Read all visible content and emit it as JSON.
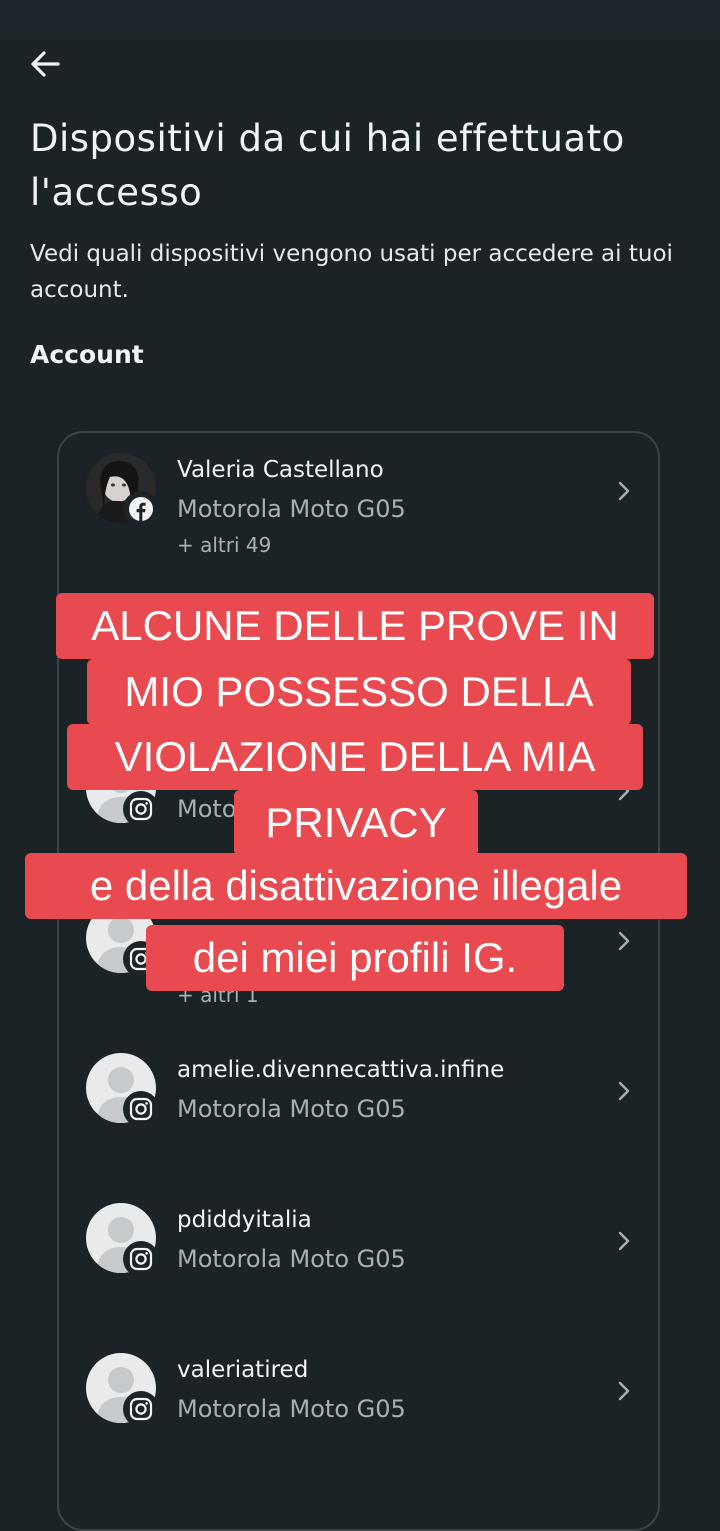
{
  "header": {
    "title": "Dispositivi da cui hai effettuato l'accesso",
    "subtitle": "Vedi quali dispositivi vengono usati per accedere ai tuoi account.",
    "section_label": "Account"
  },
  "accounts": [
    {
      "name": "Valeria Castellano",
      "device": "Motorola Moto G05",
      "more": "+ altri 49",
      "platform": "facebook",
      "avatar": "profile-photo"
    },
    {
      "name": "",
      "device": "Moto",
      "more": "",
      "platform": "instagram",
      "avatar": "default"
    },
    {
      "name": "",
      "device": "",
      "more": "+ altri 1",
      "platform": "instagram",
      "avatar": "default"
    },
    {
      "name": "amelie.divennecattiva.infine",
      "device": "Motorola Moto G05",
      "more": "",
      "platform": "instagram",
      "avatar": "default"
    },
    {
      "name": "pdiddyitalia",
      "device": "Motorola Moto G05",
      "more": "",
      "platform": "instagram",
      "avatar": "default"
    },
    {
      "name": "valeriatired",
      "device": "Motorola Moto G05",
      "more": "",
      "platform": "instagram",
      "avatar": "default"
    }
  ],
  "overlay_caption": {
    "lines": [
      "ALCUNE DELLE PROVE IN",
      "MIO POSSESSO DELLA",
      "VIOLAZIONE DELLA MIA",
      "PRIVACY",
      "e della disattivazione illegale",
      "dei miei profili IG."
    ],
    "background": "#e84a4f",
    "text_color": "#ffffff"
  },
  "icons": {
    "back": "arrow-left-icon",
    "chevron": "chevron-right-icon",
    "facebook": "facebook-icon",
    "instagram": "instagram-icon"
  },
  "colors": {
    "background": "#1c2327",
    "card_border": "#3a4449",
    "secondary_text": "#a8b0b4"
  }
}
